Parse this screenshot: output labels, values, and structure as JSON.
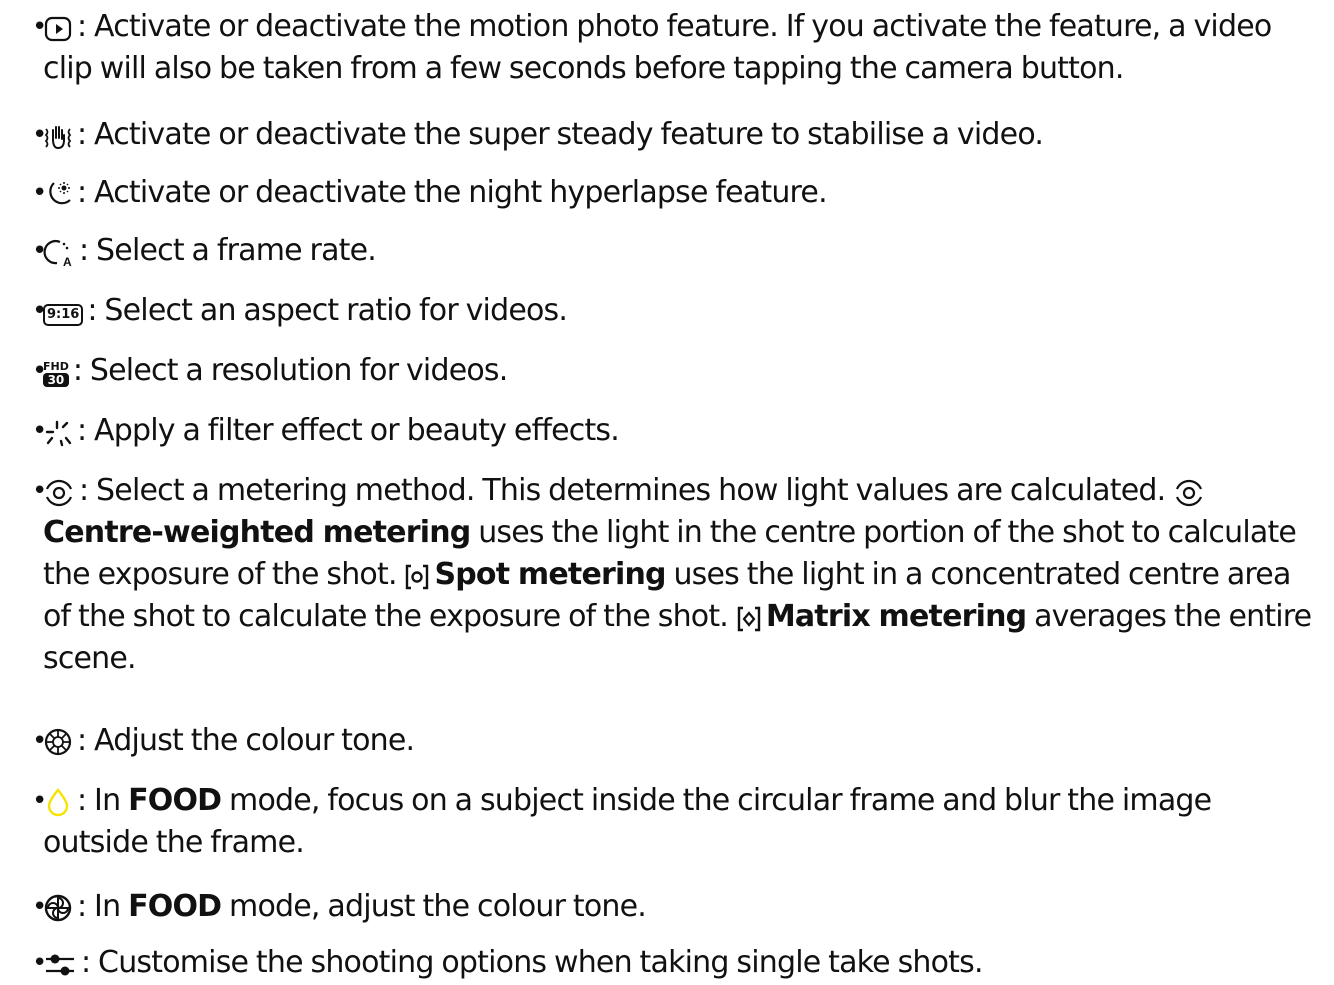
{
  "items": [
    {
      "icon": "motion-photo-icon",
      "lines": [
        ": Activate or deactivate the motion photo feature. If you activate the feature, a video",
        "clip will also be taken from a few seconds before tapping the camera button."
      ]
    },
    {
      "icon": "super-steady-icon",
      "lines": [
        ": Activate or deactivate the super steady feature to stabilise a video."
      ]
    },
    {
      "icon": "night-hyperlapse-icon",
      "lines": [
        ": Activate or deactivate the night hyperlapse feature."
      ]
    },
    {
      "icon": "frame-rate-icon",
      "lines": [
        ": Select a frame rate."
      ]
    },
    {
      "icon": "aspect-ratio-icon",
      "icon_text": "9:16",
      "lines": [
        ": Select an aspect ratio for videos."
      ]
    },
    {
      "icon": "resolution-icon",
      "icon_text_top": "FHD",
      "icon_text_bottom": "30",
      "lines": [
        ": Select a resolution for videos."
      ]
    },
    {
      "icon": "filter-effects-icon",
      "lines": [
        ": Apply a filter effect or beauty effects."
      ]
    },
    {
      "icon": "metering-icon",
      "line1": ": Select a metering method. This determines how light values are calculated.",
      "centre_label": "Centre-weighted metering",
      "centre_text": "uses the light in the centre portion of the shot to calculate",
      "line3": "the exposure of the shot.",
      "spot_label": "Spot metering",
      "spot_text": "uses the light in a concentrated centre area",
      "line4": "of the shot to calculate the exposure of the shot.",
      "matrix_label": "Matrix metering",
      "matrix_text": "averages the entire",
      "line5": "scene."
    },
    {
      "icon": "colour-tone-icon",
      "lines": [
        ": Adjust the colour tone."
      ]
    },
    {
      "icon": "food-focus-icon",
      "pre": ": In",
      "bold": "FOOD",
      "post": "mode, focus on a subject inside the circular frame and blur the image",
      "line2": "outside the frame."
    },
    {
      "icon": "food-colour-tone-icon",
      "pre": ": In",
      "bold": "FOOD",
      "post": "mode, adjust the colour tone."
    },
    {
      "icon": "single-take-options-icon",
      "lines": [
        ": Customise the shooting options when taking single take shots."
      ]
    }
  ],
  "colors": {
    "text": "#111111",
    "food_icon": "#f5e400"
  },
  "bullet": "•"
}
